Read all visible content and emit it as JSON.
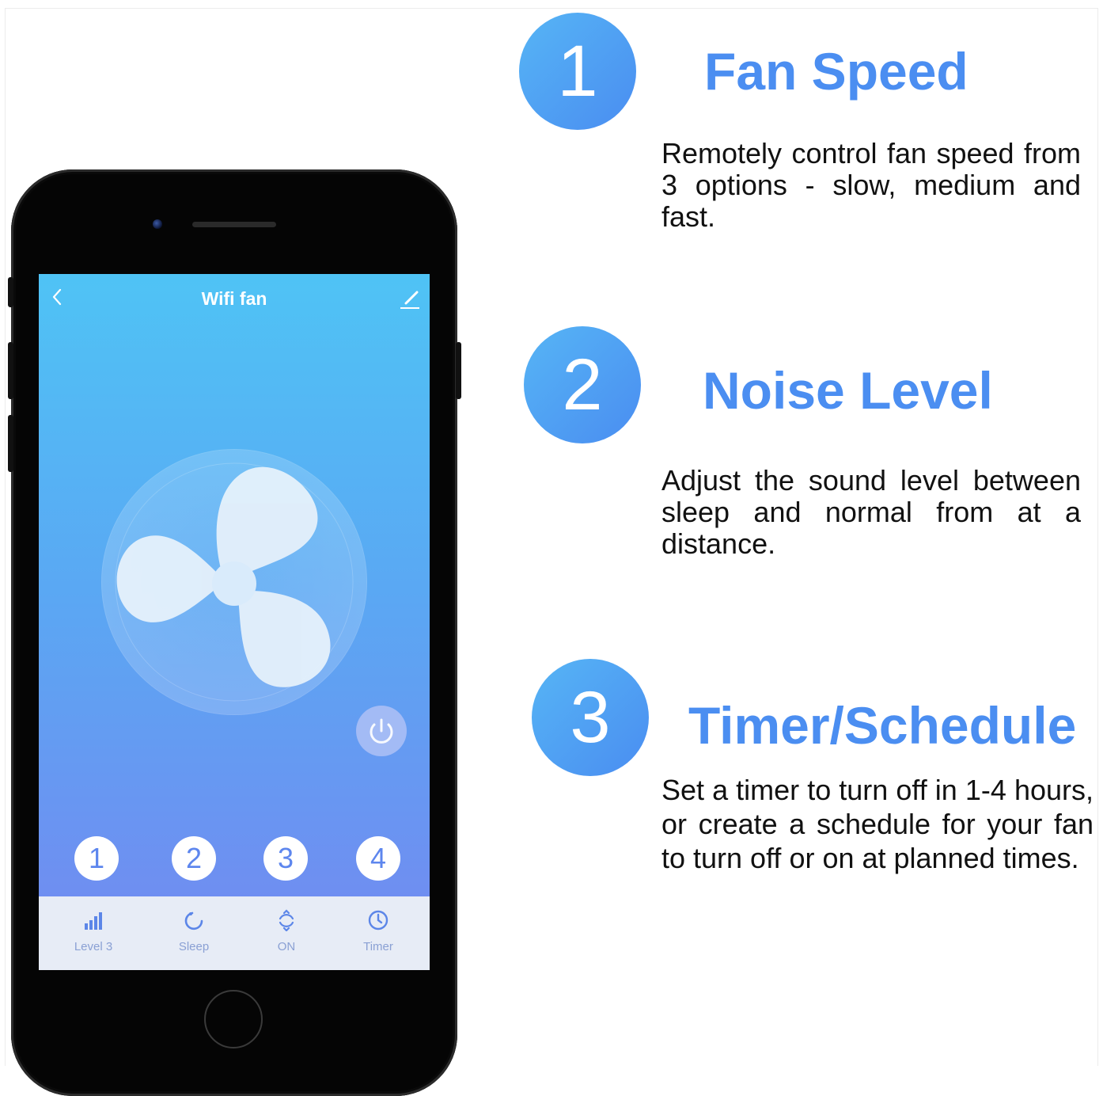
{
  "app": {
    "title": "Wifi fan",
    "back_icon": "chevron-left-icon",
    "edit_icon": "edit-pencil-icon",
    "power_icon": "power-icon"
  },
  "numbers": [
    "1",
    "2",
    "3",
    "4"
  ],
  "tabs": [
    {
      "label": "Level 3",
      "icon": "signal-bars-icon"
    },
    {
      "label": "Sleep",
      "icon": "moon-icon"
    },
    {
      "label": "ON",
      "icon": "swing-icon"
    },
    {
      "label": "Timer",
      "icon": "clock-icon"
    }
  ],
  "features": [
    {
      "number": "1",
      "title": "Fan Speed",
      "description": "Remotely control fan speed from 3 options - slow, medium and fast."
    },
    {
      "number": "2",
      "title": "Noise Level",
      "description": "Adjust the sound level between sleep and normal from at a distance."
    },
    {
      "number": "3",
      "title": "Timer/Schedule",
      "description": "Set a timer to turn off in 1-4 hours, or create a schedule for your fan to turn off or on at planned times."
    }
  ],
  "colors": {
    "accent": "#4b8ef1",
    "badge_gradient_start": "#56b5f5",
    "badge_gradient_end": "#4a8df1",
    "screen_top": "#4fc3f5",
    "screen_bottom": "#7187ee",
    "tabbar_bg": "#e7ecf6",
    "tab_label": "#8aa0d4"
  }
}
